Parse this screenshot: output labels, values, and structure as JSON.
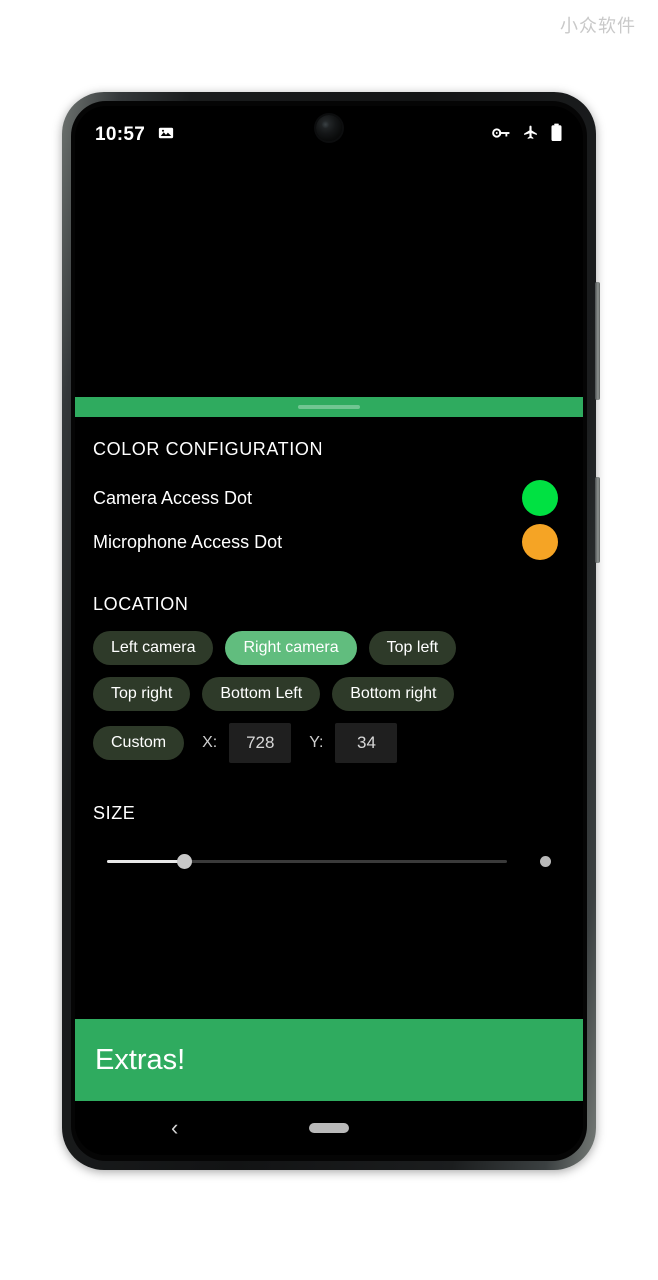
{
  "watermark": {
    "text": "小众软件"
  },
  "status_bar": {
    "time": "10:57",
    "left_icons": [
      {
        "name": "image-icon"
      }
    ],
    "right_icons": [
      {
        "name": "vpn-key-icon"
      },
      {
        "name": "airplane-mode-icon"
      },
      {
        "name": "battery-icon"
      }
    ]
  },
  "sheet": {
    "color_section": {
      "title": "COLOR CONFIGURATION",
      "rows": [
        {
          "label": "Camera Access Dot",
          "color": "#00e142"
        },
        {
          "label": "Microphone Access Dot",
          "color": "#f5a425"
        }
      ]
    },
    "location_section": {
      "title": "LOCATION",
      "chips": [
        {
          "label": "Left camera",
          "selected": false
        },
        {
          "label": "Right camera",
          "selected": true
        },
        {
          "label": "Top left",
          "selected": false
        },
        {
          "label": "Top right",
          "selected": false
        },
        {
          "label": "Bottom Left",
          "selected": false
        },
        {
          "label": "Bottom right",
          "selected": false
        },
        {
          "label": "Custom",
          "selected": false
        }
      ],
      "custom_coords": {
        "x_label": "X:",
        "x_value": "728",
        "y_label": "Y:",
        "y_value": "34"
      }
    },
    "size_section": {
      "title": "SIZE",
      "slider": {
        "value_percent": 18
      }
    },
    "extras": {
      "label": "Extras!"
    }
  },
  "nav_bar": {
    "back_glyph": "‹",
    "home_indicator": "home-pill"
  },
  "theme": {
    "accent_green": "#2fab5f",
    "chip_unselected": "#2e3a29",
    "chip_selected": "#61bd7e",
    "background": "#000000"
  }
}
